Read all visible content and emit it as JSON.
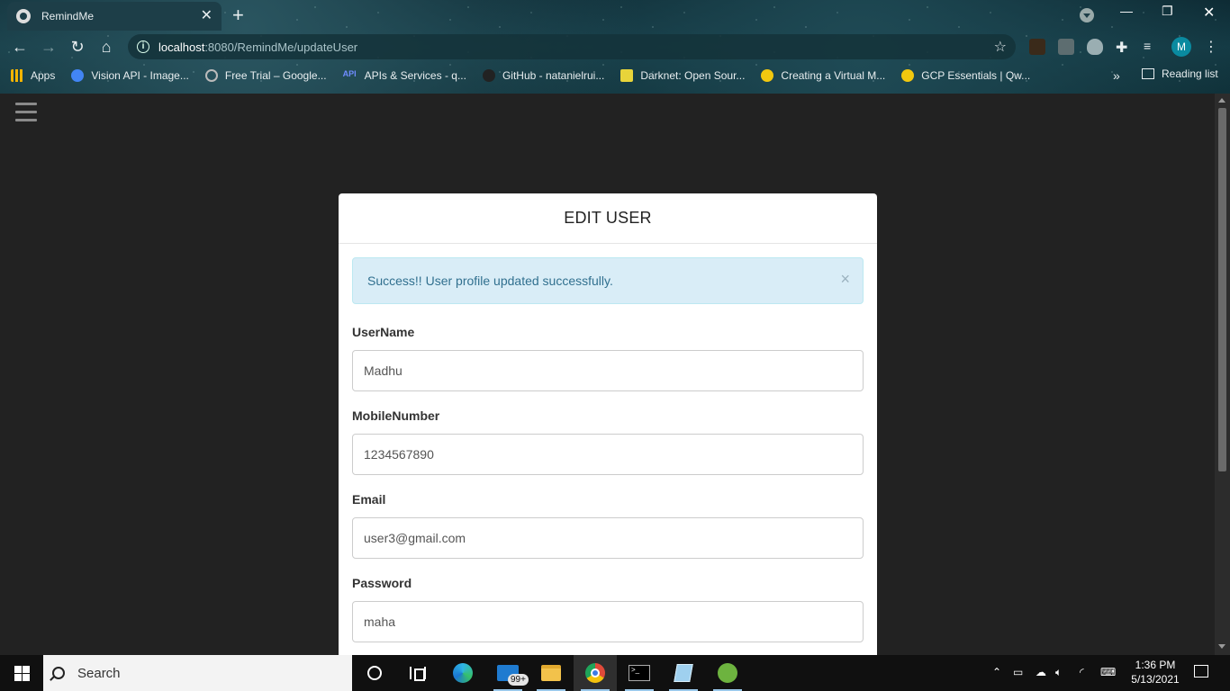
{
  "browser": {
    "tab_title": "RemindMe",
    "url_host": "localhost",
    "url_path": ":8080/RemindMe/updateUser",
    "profile_initial": "M",
    "bookmarks": [
      {
        "label": "Apps",
        "color": "#f4b400"
      },
      {
        "label": "Vision API - Image...",
        "color": "#4285f4"
      },
      {
        "label": "Free Trial – Google...",
        "color": "#888888"
      },
      {
        "label": "APIs & Services - q...",
        "color": "#4a6cf7"
      },
      {
        "label": "GitHub - natanielrui...",
        "color": "#222222"
      },
      {
        "label": "Darknet: Open Sour...",
        "color": "#e8d43a"
      },
      {
        "label": "Creating a Virtual M...",
        "color": "#f2c80f"
      },
      {
        "label": "GCP Essentials | Qw...",
        "color": "#f2c80f"
      }
    ],
    "reading_list": "Reading list"
  },
  "form": {
    "title": "EDIT USER",
    "alert": "Success!! User profile updated successfully.",
    "alert_close": "×",
    "fields": [
      {
        "label": "UserName",
        "value": "Madhu"
      },
      {
        "label": "MobileNumber",
        "value": "1234567890"
      },
      {
        "label": "Email",
        "value": "user3@gmail.com"
      },
      {
        "label": "Password",
        "value": "maha"
      }
    ]
  },
  "taskbar": {
    "search_placeholder": "Search",
    "mail_badge": "99+",
    "time": "1:36 PM",
    "date": "5/13/2021"
  }
}
